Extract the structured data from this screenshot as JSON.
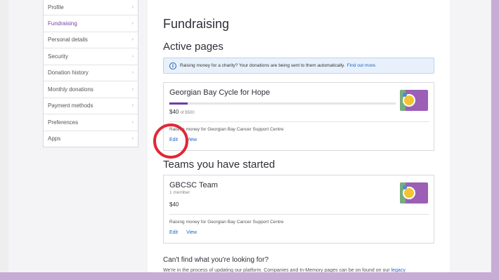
{
  "sidebar": {
    "items": [
      {
        "label": "Profile",
        "active": false
      },
      {
        "label": "Fundraising",
        "active": true
      },
      {
        "label": "Personal details",
        "active": false
      },
      {
        "label": "Security",
        "active": false
      },
      {
        "label": "Donation history",
        "active": false
      },
      {
        "label": "Monthly donations",
        "active": false
      },
      {
        "label": "Payment methods",
        "active": false
      },
      {
        "label": "Preferences",
        "active": false
      },
      {
        "label": "Apps",
        "active": false
      }
    ],
    "chevron": "›"
  },
  "main": {
    "title": "Fundraising",
    "active_pages_heading": "Active pages",
    "notice": {
      "icon": "info-icon",
      "text": "Raising money for a charity? Your donations are being sent to them automatically.",
      "link": "Find out more."
    },
    "page_card": {
      "title": "Georgian Bay Cycle for Hope",
      "raised": "$40",
      "target": "of $500",
      "progress_fraction": 0.08,
      "cause": "Raising money for Georgian Bay Cancer Support Centre",
      "edit": "Edit",
      "view": "View"
    },
    "teams_heading": "Teams you have started",
    "team_card": {
      "title": "GBCSC Team",
      "members": "1 member",
      "raised": "$40",
      "cause": "Raising money for Georgian Bay Cancer Support Centre",
      "edit": "Edit",
      "view": "View"
    },
    "help": {
      "heading": "Can't find what you're looking for?",
      "text": "We're in the process of updating our platform. Companies and In-Memory pages can be on found on our",
      "link": "legacy"
    }
  },
  "colors": {
    "accent": "#7b3fa0",
    "link": "#1f63c5",
    "progress": "#6a3ea1",
    "highlight_circle": "#e02838",
    "frame": "#c7acd6"
  }
}
